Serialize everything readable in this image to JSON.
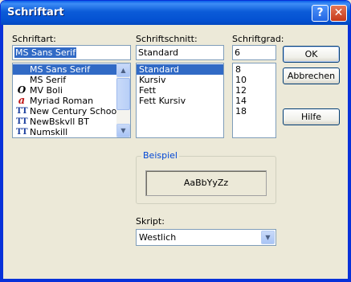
{
  "window": {
    "title": "Schriftart",
    "help_button": "?",
    "close_button": "✕"
  },
  "font_name": {
    "label": "Schriftart:",
    "value": "MS Sans Serif",
    "items": [
      {
        "label": "MS Sans Serif",
        "icon": "none",
        "selected": true
      },
      {
        "label": "MS Serif",
        "icon": "none",
        "selected": false
      },
      {
        "label": "MV Boli",
        "icon": "opentype-icon",
        "selected": false
      },
      {
        "label": "Myriad Roman",
        "icon": "adobe-type1-icon",
        "selected": false
      },
      {
        "label": "New Century Schoolbo",
        "icon": "truetype-icon",
        "selected": false
      },
      {
        "label": "NewBskvll BT",
        "icon": "truetype-icon",
        "selected": false
      },
      {
        "label": "Numskill",
        "icon": "truetype-icon",
        "selected": false
      }
    ]
  },
  "font_style": {
    "label": "Schriftschnitt:",
    "value": "Standard",
    "items": [
      {
        "label": "Standard",
        "selected": true
      },
      {
        "label": "Kursiv",
        "selected": false
      },
      {
        "label": "Fett",
        "selected": false
      },
      {
        "label": "Fett Kursiv",
        "selected": false
      }
    ]
  },
  "font_size": {
    "label": "Schriftgrad:",
    "value": "6",
    "items": [
      "8",
      "10",
      "12",
      "14",
      "18"
    ]
  },
  "buttons": {
    "ok": "OK",
    "cancel": "Abbrechen",
    "help": "Hilfe"
  },
  "sample": {
    "group_label": "Beispiel",
    "text": "AaBbYyZz"
  },
  "script": {
    "label": "Skript:",
    "value": "Westlich"
  },
  "colors": {
    "title_bar": "#0A5FE8",
    "selection": "#316AC5",
    "dialog_bg": "#ECE9D8",
    "group_label": "#0046D5"
  }
}
